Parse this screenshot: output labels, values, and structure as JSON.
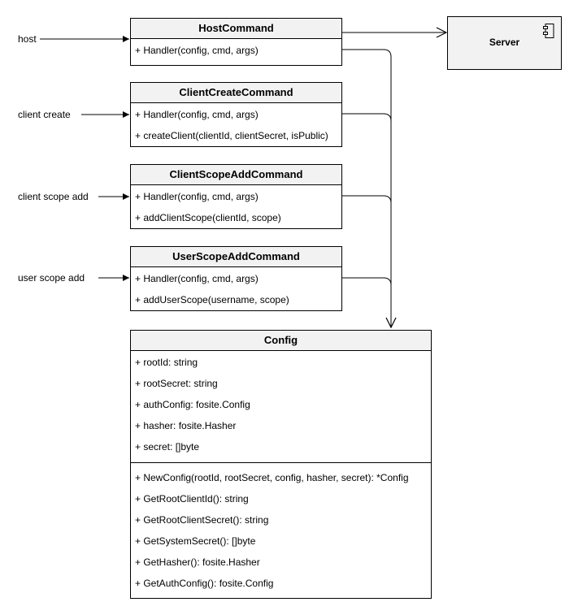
{
  "entry_labels": {
    "host": "host",
    "client_create": "client create",
    "client_scope_add": "client scope add",
    "user_scope_add": "user scope add"
  },
  "server": {
    "title": "Server",
    "icon": "component-icon"
  },
  "classes": {
    "host_command": {
      "name": "HostCommand",
      "methods": [
        "+ Handler(config, cmd, args)"
      ]
    },
    "client_create_command": {
      "name": "ClientCreateCommand",
      "methods": [
        "+ Handler(config, cmd, args)",
        "+ createClient(clientId, clientSecret, isPublic)"
      ]
    },
    "client_scope_add_command": {
      "name": "ClientScopeAddCommand",
      "methods": [
        "+ Handler(config, cmd, args)",
        "+ addClientScope(clientId, scope)"
      ]
    },
    "user_scope_add_command": {
      "name": "UserScopeAddCommand",
      "methods": [
        "+ Handler(config, cmd, args)",
        "+ addUserScope(username, scope)"
      ]
    },
    "config": {
      "name": "Config",
      "attributes": [
        "+ rootId: string",
        "+ rootSecret: string",
        "+ authConfig: fosite.Config",
        "+ hasher: fosite.Hasher",
        "+ secret: []byte"
      ],
      "methods": [
        "+ NewConfig(rootId, rootSecret, config, hasher, secret): *Config",
        "+ GetRootClientId(): string",
        "+ GetRootClientSecret(): string",
        "+ GetSystemSecret(): []byte",
        "+ GetHasher(): fosite.Hasher",
        "+ GetAuthConfig(): fosite.Config"
      ]
    }
  }
}
